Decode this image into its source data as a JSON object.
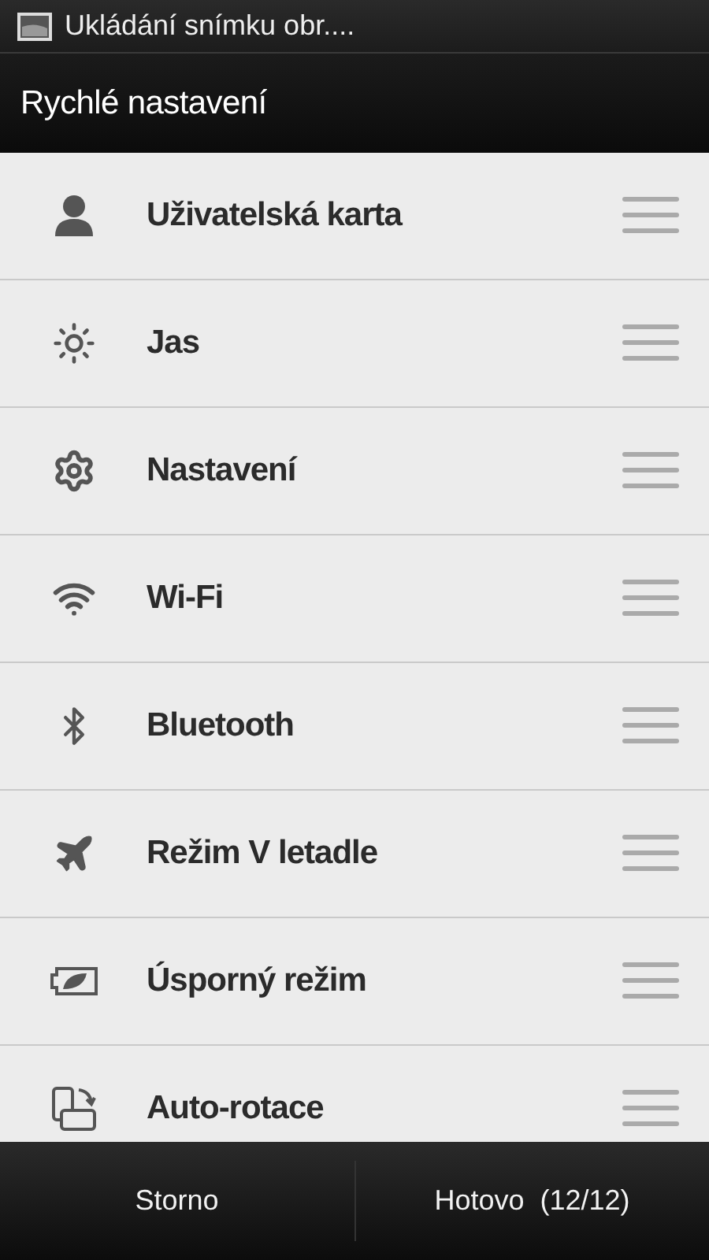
{
  "status_bar": {
    "notification": "Ukládání snímku obr...."
  },
  "header": {
    "title": "Rychlé nastavení"
  },
  "items": [
    {
      "kind": "user",
      "label": "Uživatelská karta"
    },
    {
      "kind": "brightness",
      "label": "Jas"
    },
    {
      "kind": "settings",
      "label": "Nastavení"
    },
    {
      "kind": "wifi",
      "label": "Wi-Fi"
    },
    {
      "kind": "bluetooth",
      "label": "Bluetooth"
    },
    {
      "kind": "airplane",
      "label": "Režim V letadle"
    },
    {
      "kind": "power_saver",
      "label": "Úsporný režim"
    },
    {
      "kind": "rotation",
      "label": "Auto-rotace"
    }
  ],
  "footer": {
    "cancel": "Storno",
    "done": "Hotovo  (12/12)"
  }
}
